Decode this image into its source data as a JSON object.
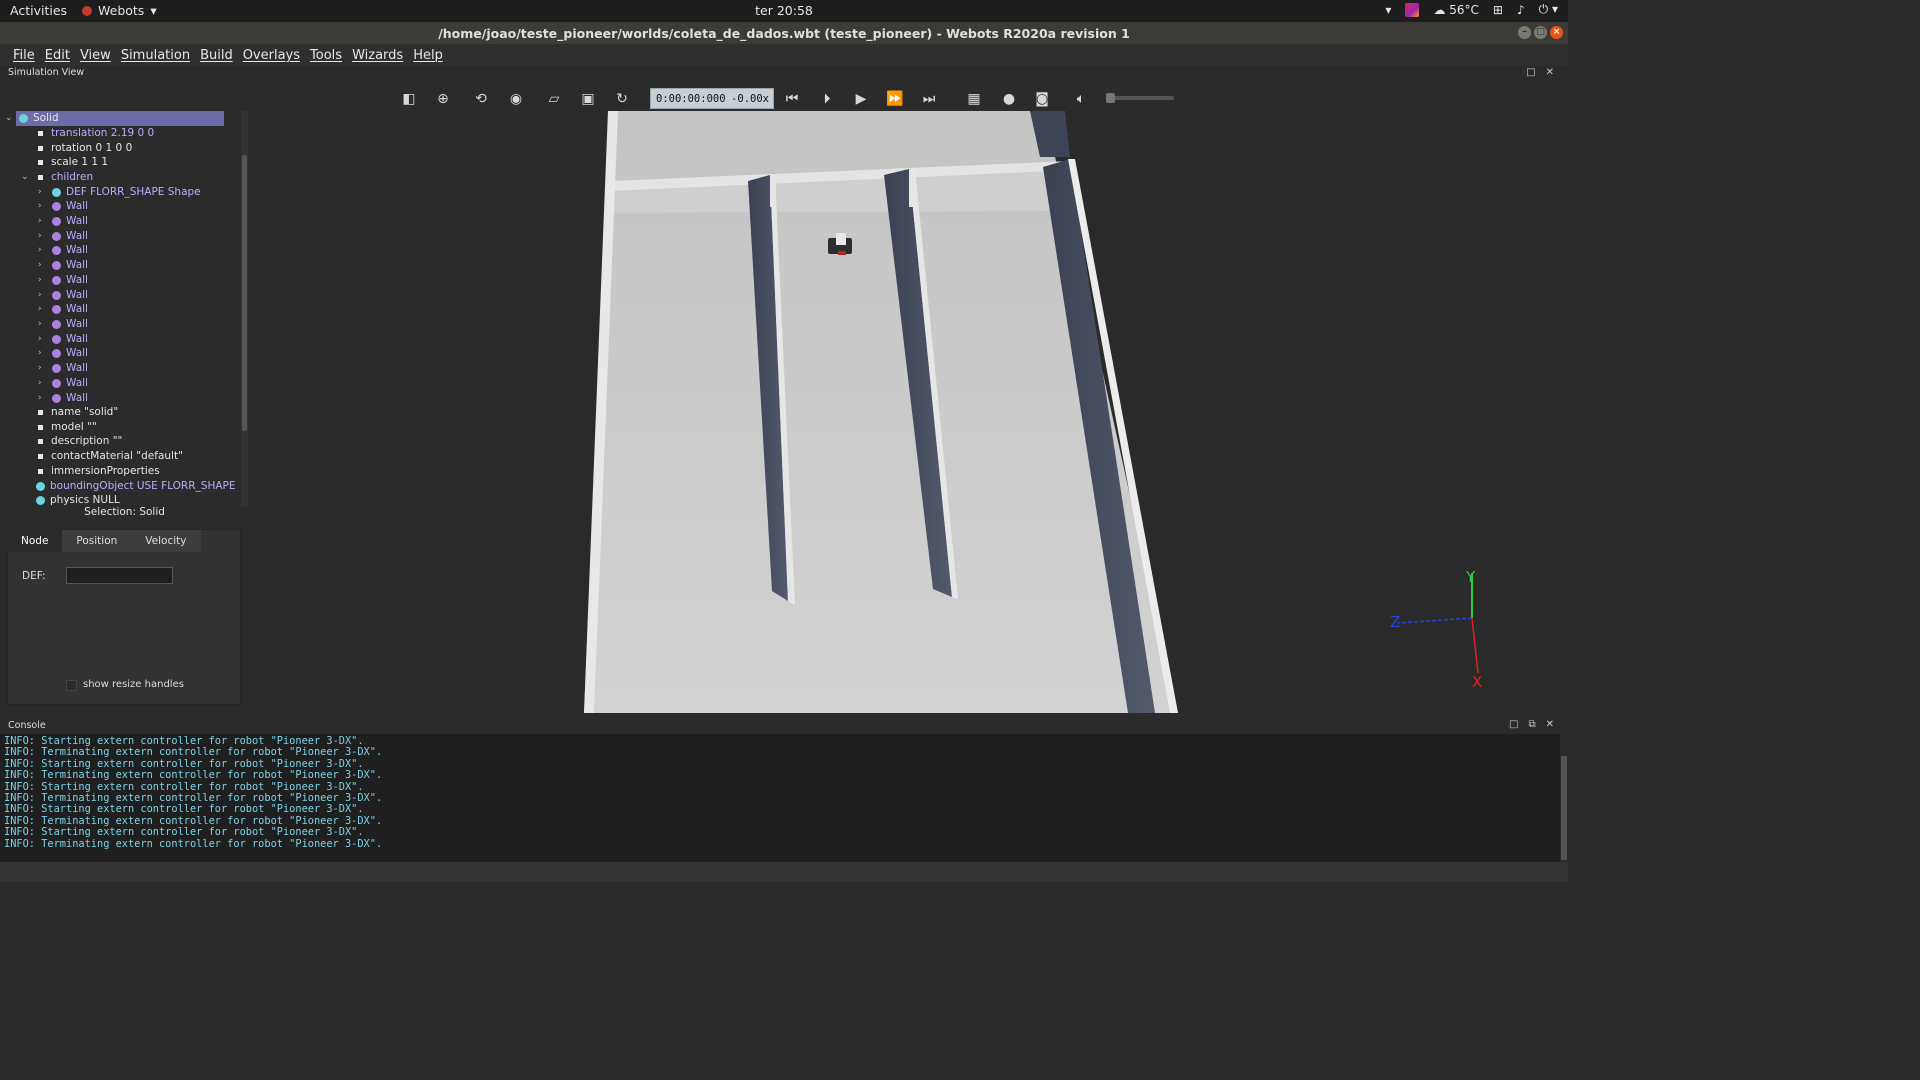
{
  "topbar": {
    "activities": "Activities",
    "app_name": "Webots",
    "clock": "ter 20:58",
    "temperature": "56°C"
  },
  "window": {
    "title": "/home/joao/teste_pioneer/worlds/coleta_de_dados.wbt (teste_pioneer) - Webots R2020a revision 1"
  },
  "menu": [
    "File",
    "Edit",
    "View",
    "Simulation",
    "Build",
    "Overlays",
    "Tools",
    "Wizards",
    "Help"
  ],
  "simulation_view_label": "Simulation View",
  "toolbar": {
    "time": "0:00:00:000",
    "separator": "-",
    "speed": "0.00x"
  },
  "tree": {
    "root": "Solid",
    "fields": {
      "translation": "translation 2.19 0 0",
      "rotation": "rotation 0 1 0 0",
      "scale": "scale 1 1 1",
      "children": "children",
      "child_shape": "DEF FLORR_SHAPE Shape",
      "walls": [
        "Wall",
        "Wall",
        "Wall",
        "Wall",
        "Wall",
        "Wall",
        "Wall",
        "Wall",
        "Wall",
        "Wall",
        "Wall",
        "Wall",
        "Wall",
        "Wall"
      ],
      "name": "name \"solid\"",
      "model": "model \"\"",
      "description": "description \"\"",
      "contactMaterial": "contactMaterial \"default\"",
      "immersionProperties": "immersionProperties",
      "boundingObject": "boundingObject USE FLORR_SHAPE",
      "physics": "physics NULL"
    }
  },
  "selection": "Selection: Solid",
  "field_editor": {
    "tabs": [
      "Node",
      "Position",
      "Velocity"
    ],
    "def_label": "DEF:",
    "def_value": "",
    "show_resize_handles": "show resize handles"
  },
  "axes": {
    "y": "Y",
    "z": "Z",
    "x": "X"
  },
  "console": {
    "title": "Console",
    "lines": [
      "INFO: Starting extern controller for robot \"Pioneer 3-DX\".",
      "INFO: Terminating extern controller for robot \"Pioneer 3-DX\".",
      "INFO: Starting extern controller for robot \"Pioneer 3-DX\".",
      "INFO: Terminating extern controller for robot \"Pioneer 3-DX\".",
      "INFO: Starting extern controller for robot \"Pioneer 3-DX\".",
      "INFO: Terminating extern controller for robot \"Pioneer 3-DX\".",
      "INFO: Starting extern controller for robot \"Pioneer 3-DX\".",
      "INFO: Terminating extern controller for robot \"Pioneer 3-DX\".",
      "INFO: Starting extern controller for robot \"Pioneer 3-DX\".",
      "INFO: Terminating extern controller for robot \"Pioneer 3-DX\"."
    ]
  },
  "colors": {
    "selection": "#6e6ca8",
    "modified_field": "#b4b0ff",
    "console_text": "#7dd3e8",
    "floor": "#c9c9c9",
    "wall_side": "#44495a"
  }
}
